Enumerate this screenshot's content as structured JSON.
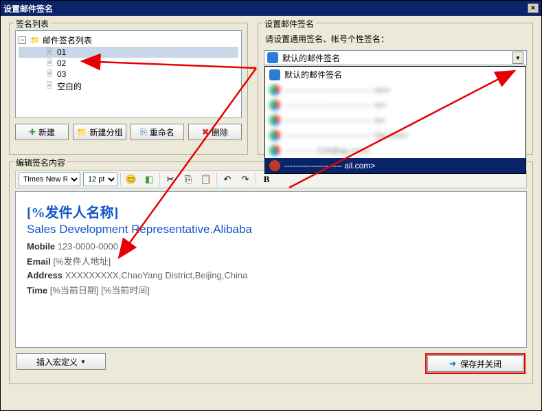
{
  "window": {
    "title": "设置邮件签名"
  },
  "sig_list_group": {
    "label": "签名列表",
    "root": "邮件签名列表",
    "items": [
      "01",
      "02",
      "03",
      "空白的"
    ],
    "selected_index": 0
  },
  "buttons": {
    "new": "新建",
    "new_group": "新建分组",
    "rename": "重命名",
    "delete": "删除"
  },
  "right_group": {
    "label": "设置邮件签名",
    "help": "请设置通用签名、帐号个性签名：",
    "selected": "默认的邮件签名"
  },
  "dropdown": {
    "items": [
      {
        "label": "默认的邮件签名",
        "avatarClass": "blue"
      },
      {
        "label": "-------------------------------- om>",
        "avatarClass": "tri",
        "blurred": true
      },
      {
        "label": "-------------------------------- m>",
        "avatarClass": "tri",
        "blurred": true
      },
      {
        "label": "-------------------------------- m>",
        "avatarClass": "tri",
        "blurred": true
      },
      {
        "label": "-------------------------------- Qq.com>",
        "avatarClass": "tri",
        "blurred": true
      },
      {
        "label": "----------- 218@qq.com>",
        "avatarClass": "tri",
        "blurred": true
      },
      {
        "label": "--------------------- ail.com>",
        "avatarClass": "red",
        "highlight": true
      }
    ]
  },
  "edit_group": {
    "label": "编辑签名内容"
  },
  "toolbar": {
    "font": "Times New Ro",
    "size": "12 pt"
  },
  "signature": {
    "name_template": "[%发件人名称]",
    "title": "Sales Development Representative.Alibaba",
    "mobile_label": "Mobile",
    "mobile_value": "123-0000-0000",
    "email_label": "Email",
    "email_value": "[%发件人地址]",
    "address_label": "Address",
    "address_value": "XXXXXXXXX,ChaoYang District,Beijing,China",
    "time_label": "Time",
    "time_value": "[%当前日期] [%当前时间]"
  },
  "bottom": {
    "macro": "插入宏定义",
    "save": "保存并关闭"
  }
}
